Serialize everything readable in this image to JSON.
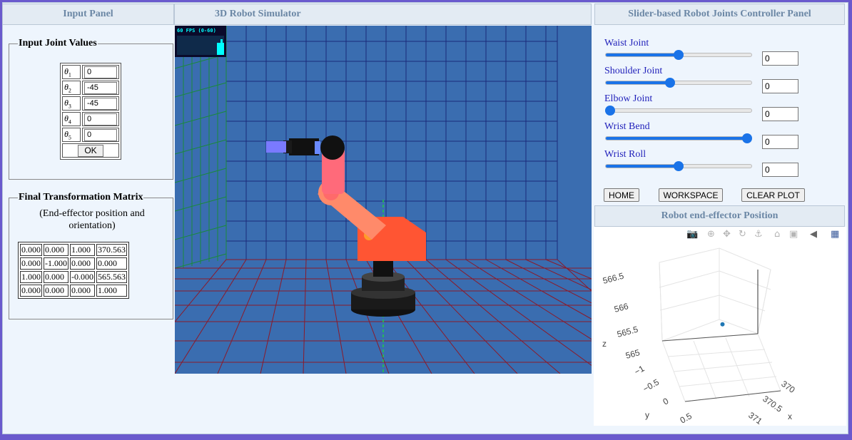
{
  "headers": {
    "input_panel": "Input Panel",
    "simulator": "3D Robot Simulator",
    "slider_panel": "Slider-based Robot Joints Controller Panel",
    "ee_panel": "Robot end-effector Position"
  },
  "input_joints": {
    "legend": "Input Joint Values",
    "rows": [
      {
        "symbol": "θ",
        "sub": "1",
        "value": "0"
      },
      {
        "symbol": "θ",
        "sub": "2",
        "value": "-45"
      },
      {
        "symbol": "θ",
        "sub": "3",
        "value": "-45"
      },
      {
        "symbol": "θ",
        "sub": "4",
        "value": "0"
      },
      {
        "symbol": "θ",
        "sub": "5",
        "value": "0"
      }
    ],
    "ok_label": "OK"
  },
  "matrix": {
    "legend": "Final Transformation Matrix",
    "subtitle": "(End-effector position and orientation)",
    "rows": [
      [
        "0.000",
        "0.000",
        "1.000",
        "370.563"
      ],
      [
        "0.000",
        "-1.000",
        "0.000",
        "0.000"
      ],
      [
        "1.000",
        "0.000",
        "-0.000",
        "565.563"
      ],
      [
        "0.000",
        "0.000",
        "0.000",
        "1.000"
      ]
    ]
  },
  "simulator": {
    "fps_label": "60 FPS (0-60)",
    "colors": {
      "floor": "#3a6db0",
      "grid_floor": "#8b1a2a",
      "grid_wall": "#1a2a7a",
      "grid_left": "#1a8a3a",
      "arm": "#ff5533",
      "link": "#ff6a6a"
    }
  },
  "sliders": [
    {
      "label": "Waist Joint",
      "value": "0",
      "fraction": 0.5
    },
    {
      "label": "Shoulder Joint",
      "value": "0",
      "fraction": 0.44
    },
    {
      "label": "Elbow Joint",
      "value": "0",
      "fraction": 0.03
    },
    {
      "label": "Wrist Bend",
      "value": "0",
      "fraction": 0.97
    },
    {
      "label": "Wrist Roll",
      "value": "0",
      "fraction": 0.5
    }
  ],
  "buttons": {
    "home": "HOME",
    "workspace": "WORKSPACE",
    "clear_plot": "CLEAR PLOT"
  },
  "plot": {
    "toolbar_icons": [
      "camera-icon",
      "zoom-icon",
      "pan-icon",
      "orbit-icon",
      "turntable-icon",
      "home-icon",
      "reset-camera-icon",
      "hover-icon",
      "plotly-logo-icon"
    ],
    "z_ticks": [
      "566.5",
      "566",
      "565.5",
      "565"
    ],
    "y_ticks": [
      "−1",
      "−0.5",
      "0",
      "0.5"
    ],
    "x_ticks": [
      "370",
      "370.5",
      "371"
    ],
    "z_label": "z",
    "y_label": "y",
    "x_label": "x"
  },
  "chart_data": {
    "type": "scatter",
    "x": [
      370.563
    ],
    "y": [
      0.0
    ],
    "z": [
      565.563
    ],
    "xlabel": "x",
    "ylabel": "y",
    "zlabel": "z",
    "xlim": [
      370,
      371
    ],
    "ylim": [
      -1,
      0.5
    ],
    "zlim": [
      565,
      566.5
    ]
  }
}
